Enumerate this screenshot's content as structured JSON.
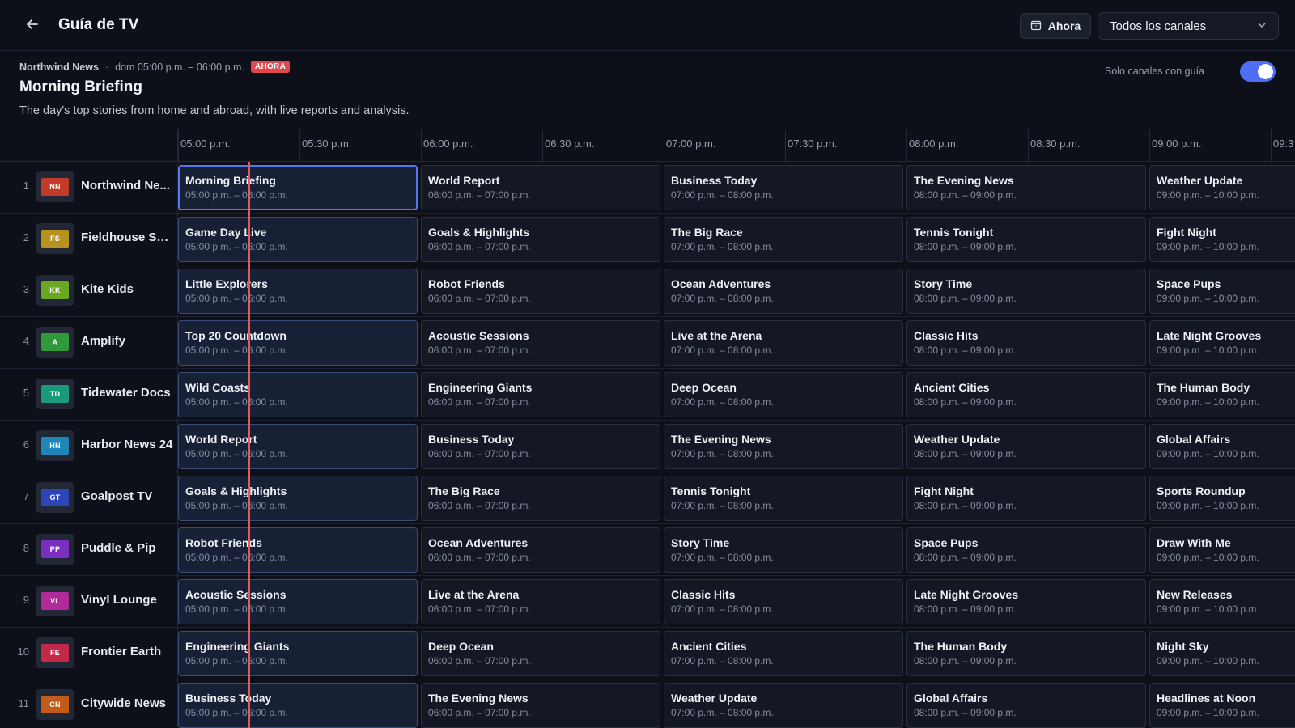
{
  "header": {
    "title": "Guía de TV",
    "now_label": "Ahora",
    "channel_filter": "Todos los canales"
  },
  "info": {
    "channel": "Northwind News",
    "time": "dom 05:00 p.m. – 06:00 p.m.",
    "badge": "AHORA",
    "title": "Morning Briefing",
    "description": "The day's top stories from home and abroad, with live reports and analysis.",
    "toggle_label": "Solo canales con guía",
    "toggle_on": true
  },
  "timeline": [
    "05:00 p.m.",
    "05:30 p.m.",
    "06:00 p.m.",
    "06:30 p.m.",
    "07:00 p.m.",
    "07:30 p.m.",
    "08:00 p.m.",
    "08:30 p.m.",
    "09:00 p.m.",
    "09:3"
  ],
  "slots": [
    "05:00 p.m. – 06:00 p.m.",
    "06:00 p.m. – 07:00 p.m.",
    "07:00 p.m. – 08:00 p.m.",
    "08:00 p.m. – 09:00 p.m.",
    "09:00 p.m. – 10:00 p.m."
  ],
  "channels": [
    {
      "number": "1",
      "name": "Northwind Ne...",
      "logo": "NN",
      "color": "#c23a2a",
      "programs": [
        "Morning Briefing",
        "World Report",
        "Business Today",
        "The Evening News",
        "Weather Update"
      ]
    },
    {
      "number": "2",
      "name": "Fieldhouse Sp...",
      "logo": "FS",
      "color": "#b8921e",
      "programs": [
        "Game Day Live",
        "Goals & Highlights",
        "The Big Race",
        "Tennis Tonight",
        "Fight Night"
      ]
    },
    {
      "number": "3",
      "name": "Kite Kids",
      "logo": "KK",
      "color": "#6aa821",
      "programs": [
        "Little Explorers",
        "Robot Friends",
        "Ocean Adventures",
        "Story Time",
        "Space Pups"
      ]
    },
    {
      "number": "4",
      "name": "Amplify",
      "logo": "A",
      "color": "#2e9a3a",
      "programs": [
        "Top 20 Countdown",
        "Acoustic Sessions",
        "Live at the Arena",
        "Classic Hits",
        "Late Night Grooves"
      ]
    },
    {
      "number": "5",
      "name": "Tidewater Docs",
      "logo": "TD",
      "color": "#1a9a7a",
      "programs": [
        "Wild Coasts",
        "Engineering Giants",
        "Deep Ocean",
        "Ancient Cities",
        "The Human Body"
      ]
    },
    {
      "number": "6",
      "name": "Harbor News 24",
      "logo": "HN",
      "color": "#1f86b8",
      "programs": [
        "World Report",
        "Business Today",
        "The Evening News",
        "Weather Update",
        "Global Affairs"
      ]
    },
    {
      "number": "7",
      "name": "Goalpost TV",
      "logo": "GT",
      "color": "#2d45b8",
      "programs": [
        "Goals & Highlights",
        "The Big Race",
        "Tennis Tonight",
        "Fight Night",
        "Sports Roundup"
      ]
    },
    {
      "number": "8",
      "name": "Puddle & Pip",
      "logo": "PP",
      "color": "#7a2fc0",
      "programs": [
        "Robot Friends",
        "Ocean Adventures",
        "Story Time",
        "Space Pups",
        "Draw With Me"
      ]
    },
    {
      "number": "9",
      "name": "Vinyl Lounge",
      "logo": "VL",
      "color": "#b02a9a",
      "programs": [
        "Acoustic Sessions",
        "Live at the Arena",
        "Classic Hits",
        "Late Night Grooves",
        "New Releases"
      ]
    },
    {
      "number": "10",
      "name": "Frontier Earth",
      "logo": "FE",
      "color": "#c22a4a",
      "programs": [
        "Engineering Giants",
        "Deep Ocean",
        "Ancient Cities",
        "The Human Body",
        "Night Sky"
      ]
    },
    {
      "number": "11",
      "name": "Citywide News",
      "logo": "CN",
      "color": "#c25a1a",
      "programs": [
        "Business Today",
        "The Evening News",
        "Weather Update",
        "Global Affairs",
        "Headlines at Noon"
      ]
    }
  ]
}
